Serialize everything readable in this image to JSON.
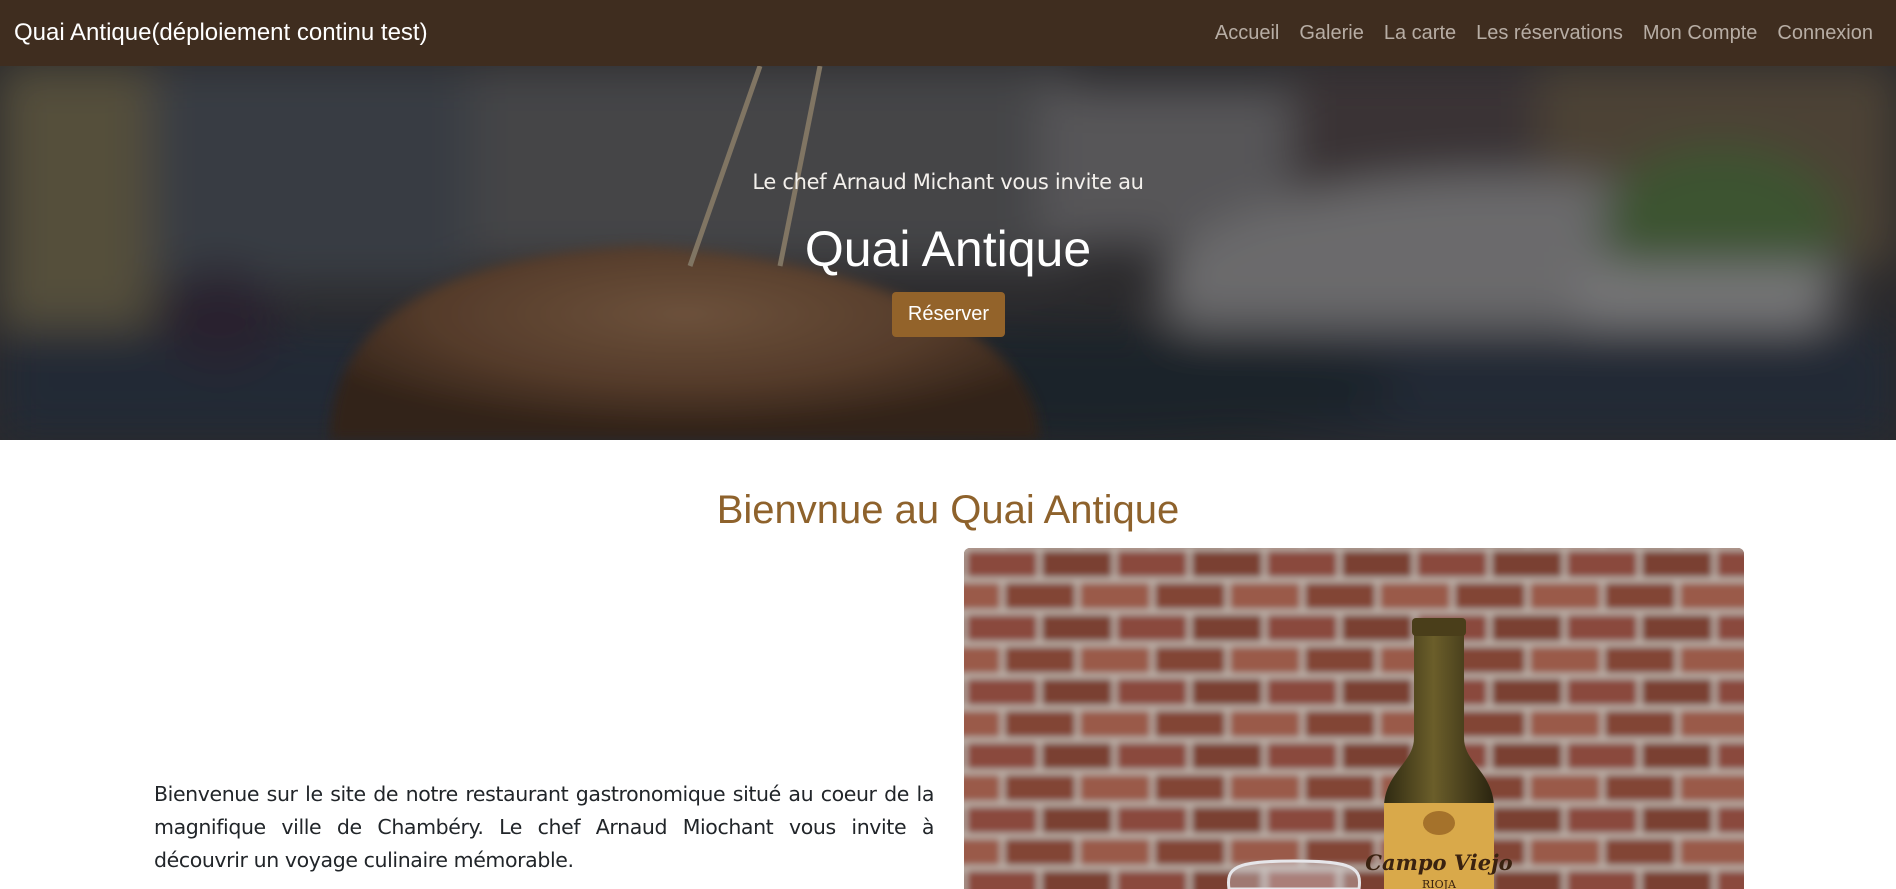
{
  "navbar": {
    "brand": "Quai Antique(déploiement continu test)",
    "links": [
      {
        "label": "Accueil"
      },
      {
        "label": "Galerie"
      },
      {
        "label": "La carte"
      },
      {
        "label": "Les réservations"
      },
      {
        "label": "Mon Compte"
      },
      {
        "label": "Connexion"
      }
    ]
  },
  "hero": {
    "subtitle": "Le chef Arnaud Michant vous invite au",
    "title": "Quai Antique",
    "reserve_label": "Réserver"
  },
  "welcome": {
    "heading": "Bienvnue au Quai Antique",
    "text": "Bienvenue sur le site de notre restaurant gastronomique situé au coeur de la magnifique ville de Chambéry. Le chef Arnaud Miochant vous invite à découvrir un voyage culinaire mémorable.",
    "bottle_label": "Campo Viejo",
    "bottle_sublabel": "RIOJA"
  },
  "colors": {
    "navbar_bg": "#3f2d1f",
    "accent": "#93632a",
    "heading": "#8e622c"
  }
}
